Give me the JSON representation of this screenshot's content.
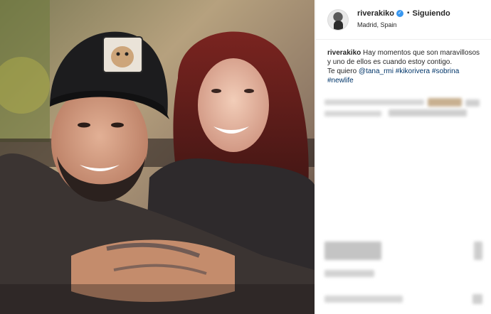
{
  "post": {
    "username": "riverakiko",
    "follow_status": "Siguiendo",
    "separator": "•",
    "location": "Madrid, Spain",
    "caption_line1": "Hay momentos que son maravillosos y uno de ellos es cuando estoy contigo.",
    "caption_line2_prefix": "Te quiero",
    "mention": "@tana_rmi",
    "hashtags": [
      "#kikorivera",
      "#sobrina",
      "#newlife"
    ]
  },
  "icons": {
    "verified": "verified-badge-icon",
    "avatar": "avatar"
  },
  "colors": {
    "link": "#003569",
    "verified": "#3897f0",
    "border": "#efefef"
  }
}
